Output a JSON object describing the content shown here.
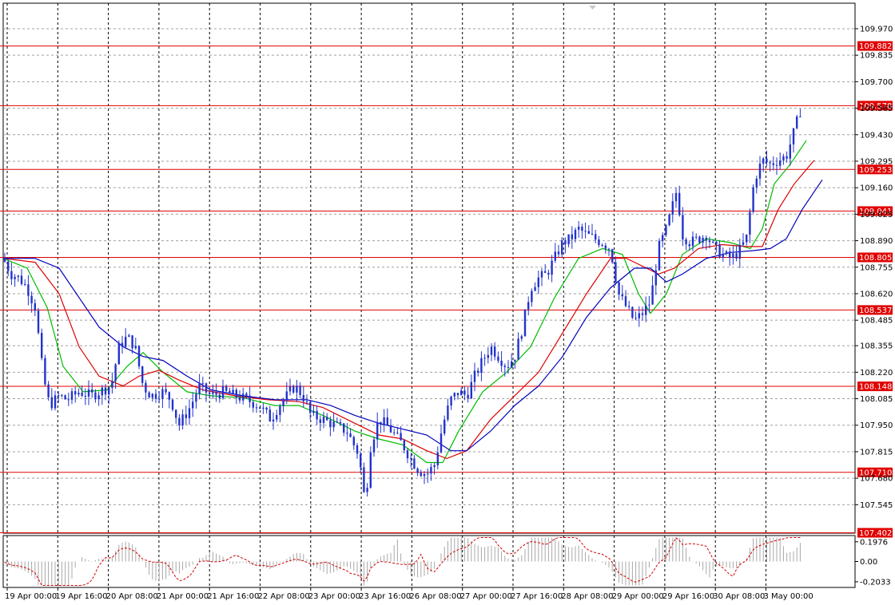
{
  "chart_data": {
    "type": "candlestick",
    "price_axis": {
      "ticks": [
        "109.970",
        "109.835",
        "109.700",
        "109.565",
        "109.430",
        "109.295",
        "109.160",
        "109.025",
        "108.890",
        "108.755",
        "108.620",
        "108.485",
        "108.355",
        "108.220",
        "108.085",
        "107.950",
        "107.815",
        "107.680",
        "107.545"
      ],
      "ylim": [
        107.4,
        110.1
      ]
    },
    "time_axis": {
      "ticks": [
        "19 Apr 00:00",
        "19 Apr 16:00",
        "20 Apr 08:00",
        "21 Apr 00:00",
        "21 Apr 16:00",
        "22 Apr 08:00",
        "23 Apr 00:00",
        "23 Apr 16:00",
        "26 Apr 08:00",
        "27 Apr 00:00",
        "27 Apr 16:00",
        "28 Apr 08:00",
        "29 Apr 00:00",
        "29 Apr 16:00",
        "30 Apr 08:00",
        "3 May 00:00"
      ]
    },
    "grid": true,
    "levels": [
      "109.882",
      "109.578",
      "109.253",
      "109.041",
      "108.805",
      "108.537",
      "108.148",
      "107.710",
      "107.402"
    ],
    "price_path": [
      [
        0,
        108.8
      ],
      [
        10,
        108.72
      ],
      [
        20,
        108.7
      ],
      [
        30,
        108.65
      ],
      [
        40,
        108.55
      ],
      [
        50,
        108.2
      ],
      [
        58,
        108.05
      ],
      [
        70,
        108.1
      ],
      [
        80,
        108.08
      ],
      [
        95,
        108.12
      ],
      [
        110,
        108.1
      ],
      [
        125,
        108.13
      ],
      [
        135,
        108.15
      ],
      [
        145,
        108.35
      ],
      [
        155,
        108.4
      ],
      [
        165,
        108.35
      ],
      [
        175,
        108.15
      ],
      [
        185,
        108.1
      ],
      [
        200,
        108.12
      ],
      [
        210,
        108.08
      ],
      [
        220,
        107.95
      ],
      [
        235,
        108.05
      ],
      [
        245,
        108.15
      ],
      [
        260,
        108.1
      ],
      [
        275,
        108.12
      ],
      [
        290,
        108.1
      ],
      [
        305,
        108.08
      ],
      [
        320,
        108.05
      ],
      [
        335,
        107.98
      ],
      [
        345,
        108.05
      ],
      [
        355,
        108.1
      ],
      [
        365,
        108.15
      ],
      [
        375,
        108.1
      ],
      [
        385,
        108.0
      ],
      [
        400,
        107.98
      ],
      [
        415,
        107.95
      ],
      [
        430,
        107.92
      ],
      [
        445,
        107.8
      ],
      [
        453,
        107.55
      ],
      [
        460,
        107.85
      ],
      [
        470,
        107.98
      ],
      [
        480,
        107.95
      ],
      [
        490,
        107.9
      ],
      [
        500,
        107.85
      ],
      [
        510,
        107.78
      ],
      [
        520,
        107.72
      ],
      [
        530,
        107.7
      ],
      [
        540,
        107.75
      ],
      [
        550,
        107.95
      ],
      [
        560,
        108.08
      ],
      [
        570,
        108.12
      ],
      [
        580,
        108.1
      ],
      [
        590,
        108.2
      ],
      [
        600,
        108.28
      ],
      [
        610,
        108.35
      ],
      [
        620,
        108.3
      ],
      [
        630,
        108.25
      ],
      [
        640,
        108.3
      ],
      [
        650,
        108.45
      ],
      [
        660,
        108.65
      ],
      [
        670,
        108.7
      ],
      [
        680,
        108.72
      ],
      [
        690,
        108.8
      ],
      [
        700,
        108.88
      ],
      [
        710,
        108.9
      ],
      [
        720,
        108.95
      ],
      [
        730,
        108.92
      ],
      [
        740,
        108.9
      ],
      [
        750,
        108.88
      ],
      [
        760,
        108.85
      ],
      [
        770,
        108.62
      ],
      [
        780,
        108.55
      ],
      [
        790,
        108.48
      ],
      [
        800,
        108.52
      ],
      [
        810,
        108.58
      ],
      [
        820,
        108.85
      ],
      [
        830,
        108.95
      ],
      [
        843,
        109.15
      ],
      [
        850,
        108.92
      ],
      [
        860,
        108.88
      ],
      [
        870,
        108.9
      ],
      [
        880,
        108.92
      ],
      [
        890,
        108.85
      ],
      [
        900,
        108.82
      ],
      [
        910,
        108.8
      ],
      [
        920,
        108.83
      ],
      [
        930,
        108.9
      ],
      [
        940,
        109.2
      ],
      [
        950,
        109.3
      ],
      [
        960,
        109.28
      ],
      [
        970,
        109.3
      ],
      [
        980,
        109.32
      ],
      [
        990,
        109.45
      ],
      [
        998,
        109.56
      ]
    ],
    "moving_averages": [
      {
        "color": "#00bb00",
        "points": [
          [
            0,
            108.8
          ],
          [
            30,
            108.75
          ],
          [
            55,
            108.55
          ],
          [
            75,
            108.25
          ],
          [
            100,
            108.12
          ],
          [
            130,
            108.13
          ],
          [
            155,
            108.25
          ],
          [
            175,
            108.32
          ],
          [
            200,
            108.22
          ],
          [
            230,
            108.12
          ],
          [
            260,
            108.1
          ],
          [
            300,
            108.09
          ],
          [
            340,
            108.05
          ],
          [
            370,
            108.05
          ],
          [
            400,
            108.0
          ],
          [
            440,
            107.92
          ],
          [
            470,
            107.88
          ],
          [
            500,
            107.85
          ],
          [
            530,
            107.76
          ],
          [
            550,
            107.76
          ],
          [
            570,
            107.92
          ],
          [
            600,
            108.12
          ],
          [
            630,
            108.22
          ],
          [
            660,
            108.35
          ],
          [
            690,
            108.6
          ],
          [
            720,
            108.8
          ],
          [
            750,
            108.85
          ],
          [
            775,
            108.82
          ],
          [
            795,
            108.62
          ],
          [
            810,
            108.52
          ],
          [
            830,
            108.62
          ],
          [
            850,
            108.82
          ],
          [
            880,
            108.9
          ],
          [
            910,
            108.88
          ],
          [
            935,
            108.85
          ],
          [
            950,
            108.95
          ],
          [
            965,
            109.18
          ],
          [
            985,
            109.28
          ],
          [
            1005,
            109.4
          ]
        ]
      },
      {
        "color": "#dd0000",
        "points": [
          [
            0,
            108.8
          ],
          [
            40,
            108.78
          ],
          [
            70,
            108.62
          ],
          [
            95,
            108.35
          ],
          [
            120,
            108.2
          ],
          [
            150,
            108.15
          ],
          [
            170,
            108.2
          ],
          [
            195,
            108.23
          ],
          [
            220,
            108.18
          ],
          [
            250,
            108.13
          ],
          [
            290,
            108.1
          ],
          [
            330,
            108.08
          ],
          [
            370,
            108.07
          ],
          [
            400,
            108.04
          ],
          [
            440,
            107.96
          ],
          [
            470,
            107.9
          ],
          [
            500,
            107.88
          ],
          [
            530,
            107.82
          ],
          [
            555,
            107.78
          ],
          [
            580,
            107.82
          ],
          [
            610,
            107.98
          ],
          [
            640,
            108.1
          ],
          [
            670,
            108.22
          ],
          [
            700,
            108.42
          ],
          [
            730,
            108.62
          ],
          [
            760,
            108.8
          ],
          [
            780,
            108.8
          ],
          [
            800,
            108.76
          ],
          [
            820,
            108.72
          ],
          [
            840,
            108.75
          ],
          [
            870,
            108.85
          ],
          [
            900,
            108.87
          ],
          [
            930,
            108.86
          ],
          [
            950,
            108.86
          ],
          [
            970,
            109.05
          ],
          [
            990,
            109.18
          ],
          [
            1015,
            109.3
          ]
        ]
      },
      {
        "color": "#0000bb",
        "points": [
          [
            0,
            108.8
          ],
          [
            40,
            108.8
          ],
          [
            70,
            108.75
          ],
          [
            95,
            108.6
          ],
          [
            120,
            108.45
          ],
          [
            150,
            108.35
          ],
          [
            175,
            108.3
          ],
          [
            200,
            108.28
          ],
          [
            230,
            108.2
          ],
          [
            260,
            108.13
          ],
          [
            300,
            108.1
          ],
          [
            340,
            108.08
          ],
          [
            380,
            108.08
          ],
          [
            410,
            108.05
          ],
          [
            440,
            108.0
          ],
          [
            470,
            107.96
          ],
          [
            500,
            107.93
          ],
          [
            530,
            107.9
          ],
          [
            560,
            107.82
          ],
          [
            580,
            107.82
          ],
          [
            610,
            107.92
          ],
          [
            640,
            108.05
          ],
          [
            670,
            108.15
          ],
          [
            700,
            108.3
          ],
          [
            730,
            108.5
          ],
          [
            760,
            108.65
          ],
          [
            790,
            108.75
          ],
          [
            810,
            108.75
          ],
          [
            830,
            108.68
          ],
          [
            850,
            108.72
          ],
          [
            880,
            108.8
          ],
          [
            910,
            108.83
          ],
          [
            940,
            108.84
          ],
          [
            960,
            108.85
          ],
          [
            980,
            108.9
          ],
          [
            1000,
            109.05
          ],
          [
            1025,
            109.2
          ]
        ]
      }
    ],
    "oscillator": {
      "ticks": [
        "0.1976",
        "0.00",
        "-0.2033"
      ],
      "ylim": [
        -0.26,
        0.26
      ]
    }
  }
}
